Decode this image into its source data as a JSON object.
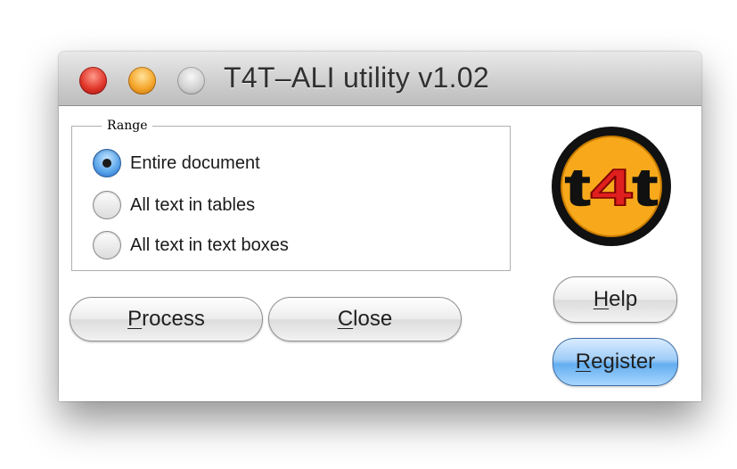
{
  "window": {
    "title": "T4T–ALI utility v1.02"
  },
  "range": {
    "legend": "Range",
    "options": [
      {
        "label": "Entire document",
        "checked": true
      },
      {
        "label": "All text in tables",
        "checked": false
      },
      {
        "label": "All text in text boxes",
        "checked": false
      }
    ]
  },
  "buttons": {
    "process": {
      "mnemonic": "P",
      "rest": "rocess"
    },
    "close": {
      "mnemonic": "C",
      "rest": "lose"
    },
    "help": {
      "mnemonic": "H",
      "rest": "elp"
    },
    "register": {
      "mnemonic": "R",
      "rest": "egister"
    }
  },
  "logo": {
    "text": "t4t"
  },
  "colors": {
    "accent": "#63aef0",
    "logo_orange": "#f7a81b",
    "logo_red": "#e01f1f"
  }
}
